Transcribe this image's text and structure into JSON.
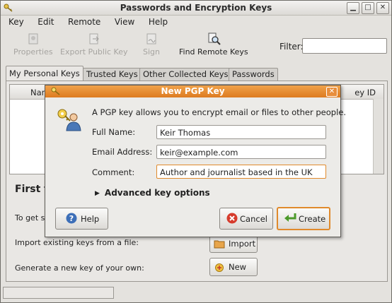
{
  "window": {
    "title": "Passwords and Encryption Keys"
  },
  "menu": [
    "Key",
    "Edit",
    "Remote",
    "View",
    "Help"
  ],
  "toolbar": {
    "properties": "Properties",
    "export": "Export Public Key",
    "sign": "Sign",
    "find_remote": "Find Remote Keys",
    "filter_label": "Filter:",
    "filter_value": ""
  },
  "tabs": [
    "My Personal Keys",
    "Trusted Keys",
    "Other Collected Keys",
    "Passwords"
  ],
  "list": {
    "col_name": "Nam",
    "col_keyid": "ey ID"
  },
  "first_time": {
    "title": "First t",
    "get_started": "To get st",
    "import_text": "Import existing keys from a file:",
    "import_button": "Import",
    "generate_text": "Generate a new key of your own:",
    "new_button": "New"
  },
  "dialog": {
    "title": "New PGP Key",
    "intro": "A PGP key allows you to encrypt email or files to other people.",
    "full_name_label": "Full Name:",
    "full_name_value": "Keir Thomas",
    "email_label": "Email Address:",
    "email_value": "keir@example.com",
    "comment_label": "Comment:",
    "comment_value": "Author and journalist based in the UK",
    "advanced": "Advanced key options",
    "help": "Help",
    "cancel": "Cancel",
    "create": "Create"
  },
  "colors": {
    "dialog_title": "#dd7b20",
    "focus": "#e08a2c"
  }
}
